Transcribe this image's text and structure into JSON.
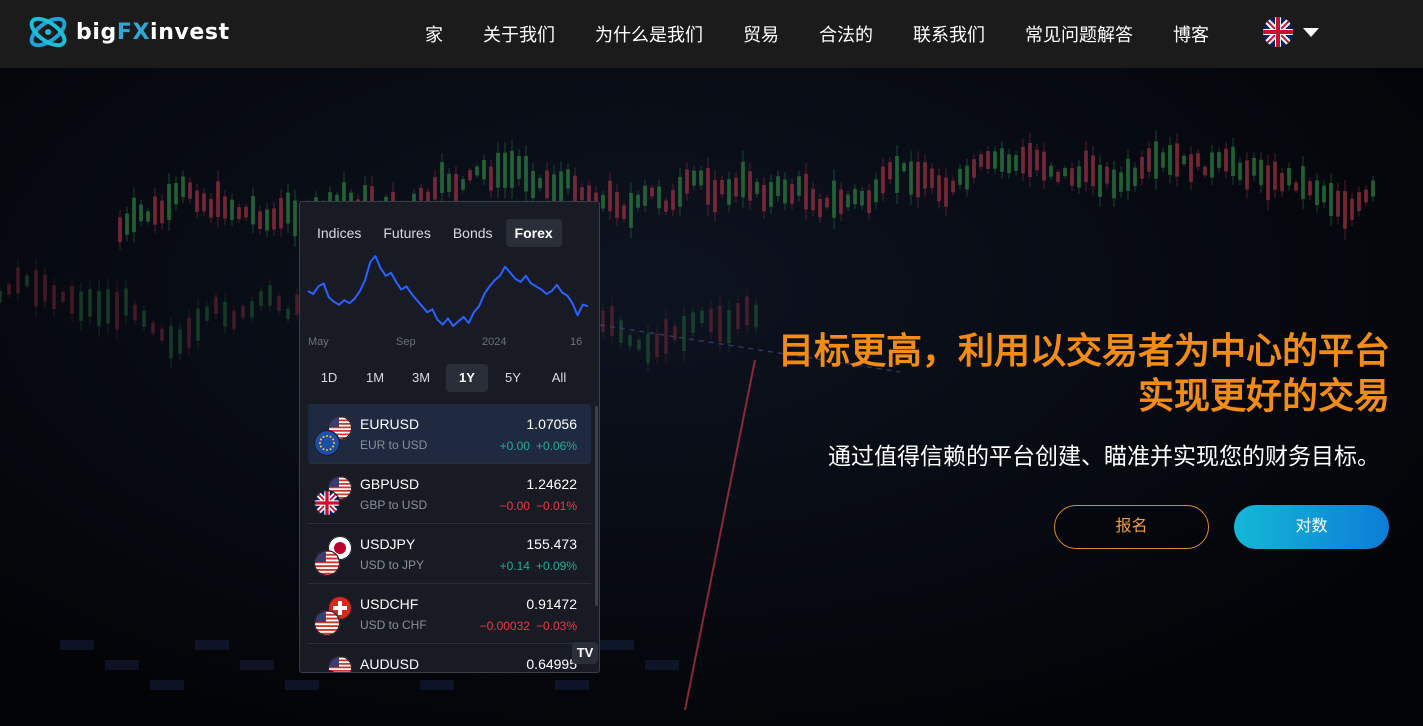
{
  "brand": {
    "prefix": "big",
    "highlight": "FX",
    "suffix": "invest"
  },
  "nav": {
    "items": [
      "家",
      "关于我们",
      "为什么是我们",
      "贸易",
      "合法的",
      "联系我们",
      "常见问题解答",
      "博客"
    ]
  },
  "widget": {
    "tabs": [
      "Indices",
      "Futures",
      "Bonds",
      "Forex"
    ],
    "active_tab": "Forex",
    "date_labels": [
      "May",
      "Sep",
      "2024",
      "16"
    ],
    "ranges": [
      "1D",
      "1M",
      "3M",
      "1Y",
      "5Y",
      "All"
    ],
    "active_range": "1Y",
    "sparkline": [
      1.08,
      1.078,
      1.083,
      1.085,
      1.076,
      1.073,
      1.071,
      1.074,
      1.072,
      1.075,
      1.08,
      1.087,
      1.099,
      1.103,
      1.095,
      1.09,
      1.092,
      1.086,
      1.081,
      1.083,
      1.078,
      1.074,
      1.07,
      1.066,
      1.068,
      1.061,
      1.058,
      1.062,
      1.057,
      1.06,
      1.063,
      1.059,
      1.066,
      1.07,
      1.078,
      1.083,
      1.087,
      1.09,
      1.096,
      1.092,
      1.088,
      1.086,
      1.09,
      1.085,
      1.083,
      1.081,
      1.078,
      1.08,
      1.084,
      1.079,
      1.077,
      1.072,
      1.064,
      1.071,
      1.07
    ],
    "rows": [
      {
        "symbol": "EURUSD",
        "desc": "EUR to USD",
        "price": "1.07056",
        "change": "+0.00",
        "pct": "+0.06%",
        "dir": "up",
        "flag_a": "us",
        "flag_b": "eu",
        "selected": true
      },
      {
        "symbol": "GBPUSD",
        "desc": "GBP to USD",
        "price": "1.24622",
        "change": "−0.00",
        "pct": "−0.01%",
        "dir": "down",
        "flag_a": "us",
        "flag_b": "gb",
        "selected": false
      },
      {
        "symbol": "USDJPY",
        "desc": "USD to JPY",
        "price": "155.473",
        "change": "+0.14",
        "pct": "+0.09%",
        "dir": "up",
        "flag_a": "jp",
        "flag_b": "us",
        "selected": false
      },
      {
        "symbol": "USDCHF",
        "desc": "USD to CHF",
        "price": "0.91472",
        "change": "−0.00032",
        "pct": "−0.03%",
        "dir": "down",
        "flag_a": "ch",
        "flag_b": "us",
        "selected": false
      },
      {
        "symbol": "AUDUSD",
        "desc": "AUD to USD",
        "price": "0.64995",
        "change": "",
        "pct": "",
        "dir": "up",
        "flag_a": "us",
        "flag_b": "au",
        "selected": false
      }
    ],
    "logo_text": "TV"
  },
  "hero": {
    "title": "目标更高，利用以交易者为中心的平台实现更好的交易",
    "subtitle": "通过值得信赖的平台创建、瞄准并实现您的财务目标。",
    "signup_label": "报名",
    "login_label": "对数"
  },
  "colors": {
    "accent_orange": "#f28c14",
    "brand_blue": "#2fa8d8",
    "up": "#22ab94",
    "down": "#f23645",
    "sparkline": "#2962ff"
  }
}
